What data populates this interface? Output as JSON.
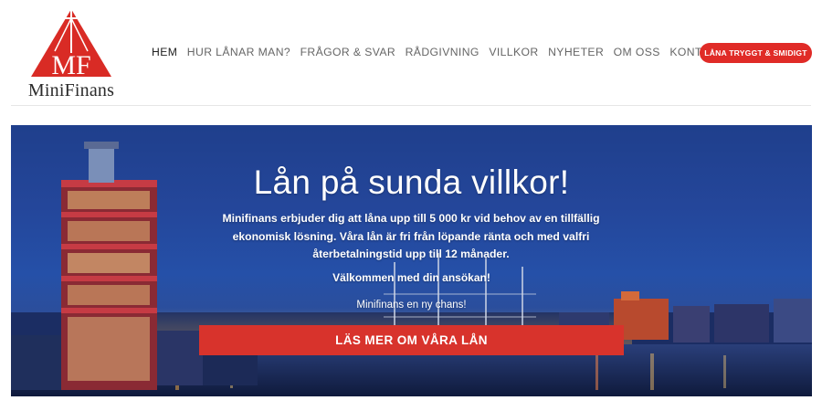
{
  "logo": {
    "monogram": "MF",
    "text": "MiniFinans"
  },
  "nav": {
    "items": [
      {
        "label": "HEM",
        "active": true
      },
      {
        "label": "HUR LÅNAR MAN?"
      },
      {
        "label": "FRÅGOR & SVAR"
      },
      {
        "label": "RÅDGIVNING"
      },
      {
        "label": "VILLKOR"
      },
      {
        "label": "NYHETER"
      },
      {
        "label": "OM OSS"
      },
      {
        "label": "KONTAKTA OSS"
      }
    ],
    "cta_label": "LÅNA TRYGGT & SMIDIGT"
  },
  "hero": {
    "title": "Lån på sunda villkor!",
    "description": "Minifinans erbjuder dig att låna upp till 5 000 kr vid behov av en tillfällig ekonomisk lösning. Våra lån är fri från löpande ränta och med valfri återbetalningstid upp till 12 månader.",
    "welcome": "Välkommen med din ansökan!",
    "tagline": "Minifinans en ny chans!",
    "button_label": "LÄS MER OM VÅRA LÅN"
  },
  "colors": {
    "brand_red": "#e02b27",
    "button_red": "#d8332c",
    "hero_sky": "#24469a",
    "text_dark": "#2b2b2b",
    "nav_text": "#666666"
  }
}
